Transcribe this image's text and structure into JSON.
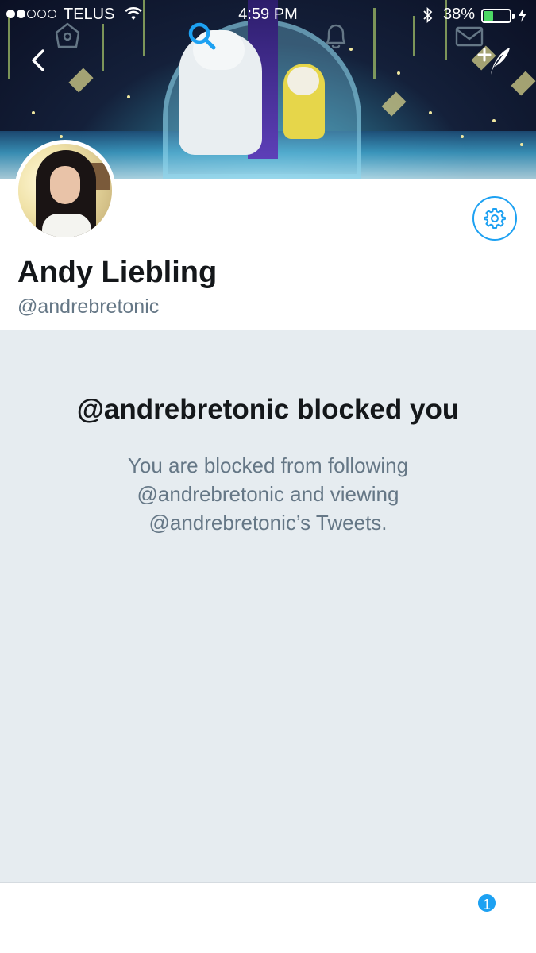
{
  "status_bar": {
    "carrier": "TELUS",
    "time": "4:59 PM",
    "battery_percent": "38%",
    "battery_level": 0.38,
    "signal_bars_filled": 2,
    "signal_bars_total": 5
  },
  "header": {
    "back_icon": "chevron-left-icon",
    "compose_icon": "compose-tweet-icon"
  },
  "profile": {
    "name": "Andy Liebling",
    "handle": "@andrebretonic",
    "settings_icon": "gear-icon"
  },
  "blocked": {
    "title": "@andrebretonic blocked you",
    "message": "You are blocked from following @andrebretonic and viewing @andrebretonic’s Tweets."
  },
  "tabbar": {
    "items": [
      {
        "name": "home",
        "icon": "home-icon"
      },
      {
        "name": "search",
        "icon": "search-icon",
        "active": true
      },
      {
        "name": "notifications",
        "icon": "bell-icon"
      },
      {
        "name": "messages",
        "icon": "mail-icon",
        "badge": "1"
      }
    ]
  },
  "colors": {
    "accent": "#1da1f2",
    "page_background": "#e6ecf0",
    "text_primary": "#14171a",
    "text_secondary": "#657786",
    "tab_icon_inactive": "#657786"
  }
}
